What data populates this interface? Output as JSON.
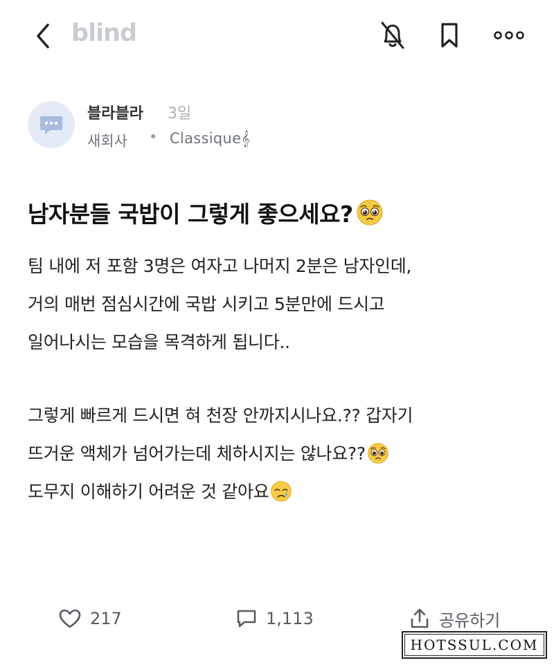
{
  "header": {
    "back_icon": "chevron-left-icon",
    "logo": "blind",
    "notification_icon": "bell-off-icon",
    "bookmark_icon": "bookmark-icon",
    "more_icon": "more-dots-icon"
  },
  "author": {
    "avatar_icon": "chat-bubble-icon",
    "name": "블라블라",
    "time": "3일",
    "company": "새회사",
    "separator": "•",
    "channel": "Classique𝄞"
  },
  "post": {
    "title": "남자분들 국밥이 그렇게 좋으세요?",
    "body_lines": [
      "팀 내에 저 포함 3명은 여자고 나머지 2분은 남자인데,",
      "거의 매번 점심시간에 국밥 시키고 5분만에 드시고",
      "일어나시는 모습을 목격하게 됩니다..",
      "",
      "그렇게 빠르게 드시면 혀 천장 안까지시나요.?? 갑자기",
      "뜨거운 액체가 넘어가는데 체하시지는 않나요??",
      "도무지 이해하기 어려운 것 같아요"
    ]
  },
  "actions": {
    "likes": "217",
    "comments": "1,113",
    "share_label": "공유하기"
  },
  "watermark": "HOTSSUL.COM",
  "colors": {
    "logo": "#c9ccd1",
    "avatar_bg": "#e4ebf7",
    "avatar_icon": "#a9bbe0",
    "text_primary": "#111111",
    "text_secondary": "#6f747a"
  }
}
